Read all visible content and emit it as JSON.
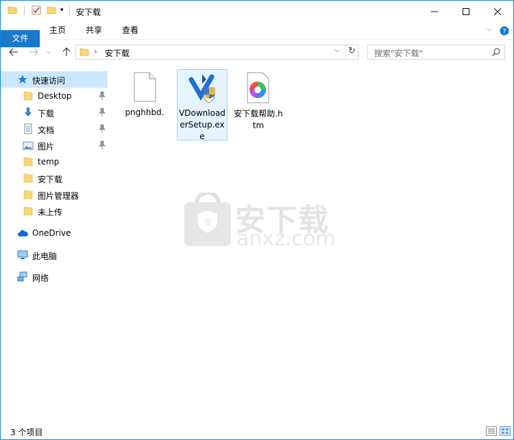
{
  "window": {
    "title": "安下载",
    "controls": [
      "minimize-icon",
      "maximize-icon",
      "close-icon"
    ]
  },
  "ribbon": {
    "tabs": [
      "文件",
      "主页",
      "共享",
      "查看"
    ]
  },
  "address": {
    "path": "安下载",
    "search_placeholder": "搜索\"安下载\""
  },
  "sidebar": {
    "quick_access": "快速访问",
    "pinned": [
      "Desktop",
      "下载",
      "文档",
      "图片"
    ],
    "recent": [
      "temp",
      "安下载",
      "图片管理器",
      "未上传"
    ],
    "onedrive": "OneDrive",
    "this_pc": "此电脑",
    "network": "网络"
  },
  "files": [
    {
      "name": "pnghhbd.",
      "icon": "blank-file-icon"
    },
    {
      "name": "VDownloaderSetup.exe",
      "icon": "installer-icon"
    },
    {
      "name": "安下载帮助.htm",
      "icon": "htm-file-icon"
    }
  ],
  "watermark": {
    "cn": "安下载",
    "en": "anxz.com",
    "badge": "安"
  },
  "status": {
    "count": "3 个项目"
  },
  "colors": {
    "accent": "#1979ca",
    "selection": "#cce8ff",
    "folder": "#f8d775"
  }
}
